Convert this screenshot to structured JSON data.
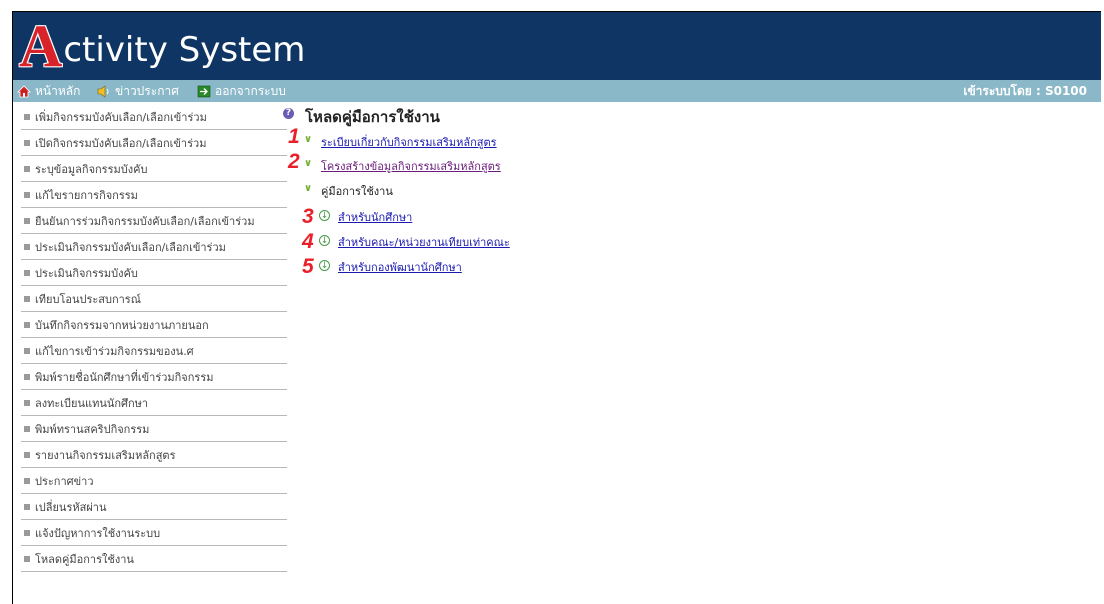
{
  "header": {
    "logo_first_letter": "A",
    "logo_rest": "ctivity System"
  },
  "navbar": {
    "home": "หน้าหลัก",
    "news": "ข่าวประกาศ",
    "logout": "ออกจากระบบ",
    "login_info": "เข้าระบบโดย : S0100"
  },
  "sidebar": {
    "items": [
      {
        "label": "เพิ่มกิจกรรมบังคับเลือก/เลือกเข้าร่วม"
      },
      {
        "label": "เปิดกิจกรรมบังคับเลือก/เลือกเข้าร่วม"
      },
      {
        "label": "ระบุข้อมูลกิจกรรมบังคับ"
      },
      {
        "label": "แก้ไขรายการกิจกรรม"
      },
      {
        "label": "ยืนยันการร่วมกิจกรรมบังคับเลือก/เลือกเข้าร่วม"
      },
      {
        "label": "ประเมินกิจกรรมบังคับเลือก/เลือกเข้าร่วม"
      },
      {
        "label": "ประเมินกิจกรรมบังคับ"
      },
      {
        "label": "เทียบโอนประสบการณ์"
      },
      {
        "label": "บันทึกกิจกรรมจากหน่วยงานภายนอก"
      },
      {
        "label": "แก้ไขการเข้าร่วมกิจกรรมของน.ศ"
      },
      {
        "label": "พิมพ์รายชื่อนักศึกษาที่เข้าร่วมกิจกรรม"
      },
      {
        "label": "ลงทะเบียนแทนนักศึกษา"
      },
      {
        "label": "พิมพ์ทรานสคริปกิจกรรม"
      },
      {
        "label": "รายงานกิจกรรมเสริมหลักสูตร"
      },
      {
        "label": "ประกาศข่าว"
      },
      {
        "label": "เปลี่ยนรหัสผ่าน"
      },
      {
        "label": "แจ้งปัญหาการใช้งานระบบ"
      },
      {
        "label": "โหลดคู่มือการใช้งาน"
      }
    ]
  },
  "content": {
    "title": "โหลดคู่มือการใช้งาน",
    "link1": "ระเบียบเกี่ยวกับกิจกรรมเสริมหลักสูตร",
    "link2": "โครงสร้างข้อมูลกิจกรรมเสริมหลักสูตร",
    "manual_label": "คู่มือการใช้งาน",
    "sub1": "สำหรับนักศึกษา",
    "sub2": "สำหรับคณะ/หน่วยงานเทียบเท่าคณะ",
    "sub3": "สำหรับกองพัฒนานักศึกษา",
    "annotations": [
      "1",
      "2",
      "3",
      "4",
      "5"
    ]
  },
  "colors": {
    "banner": "#0e3563",
    "navbar": "#8ab8c8",
    "annotation_red": "#e8202a",
    "chevron_green": "#6fae2a",
    "link_blue": "#1a1ab0"
  }
}
